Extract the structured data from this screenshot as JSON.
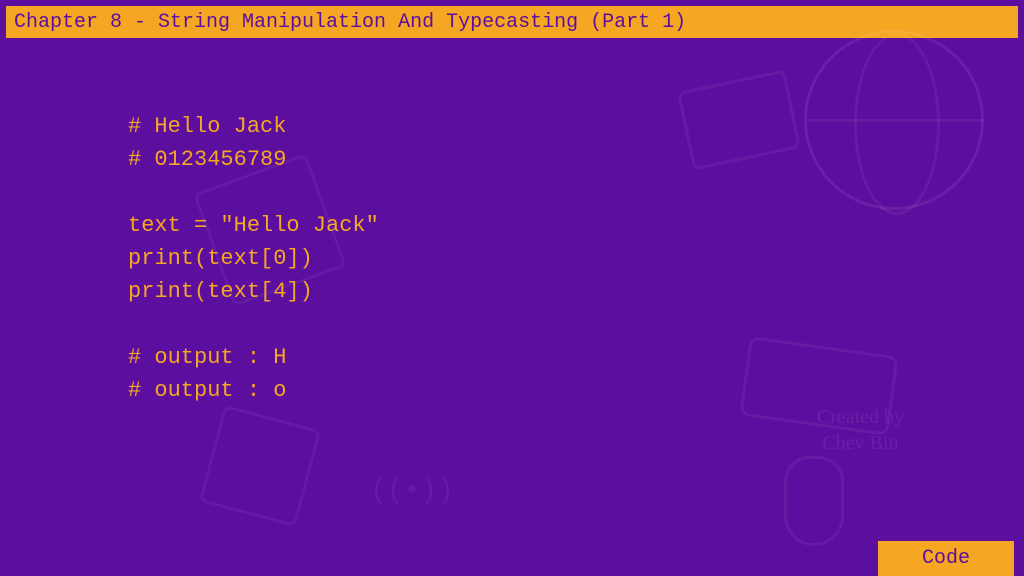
{
  "header": {
    "title": "Chapter 8 - String Manipulation And Typecasting (Part 1)"
  },
  "code": {
    "lines": [
      "# Hello Jack",
      "# 0123456789",
      "",
      "text = \"Hello Jack\"",
      "print(text[0])",
      "print(text[4])",
      "",
      "# output : H",
      "# output : o"
    ]
  },
  "footer": {
    "label": "Code"
  },
  "watermark": {
    "created_by": "Created by",
    "author": "Chev Bin"
  }
}
